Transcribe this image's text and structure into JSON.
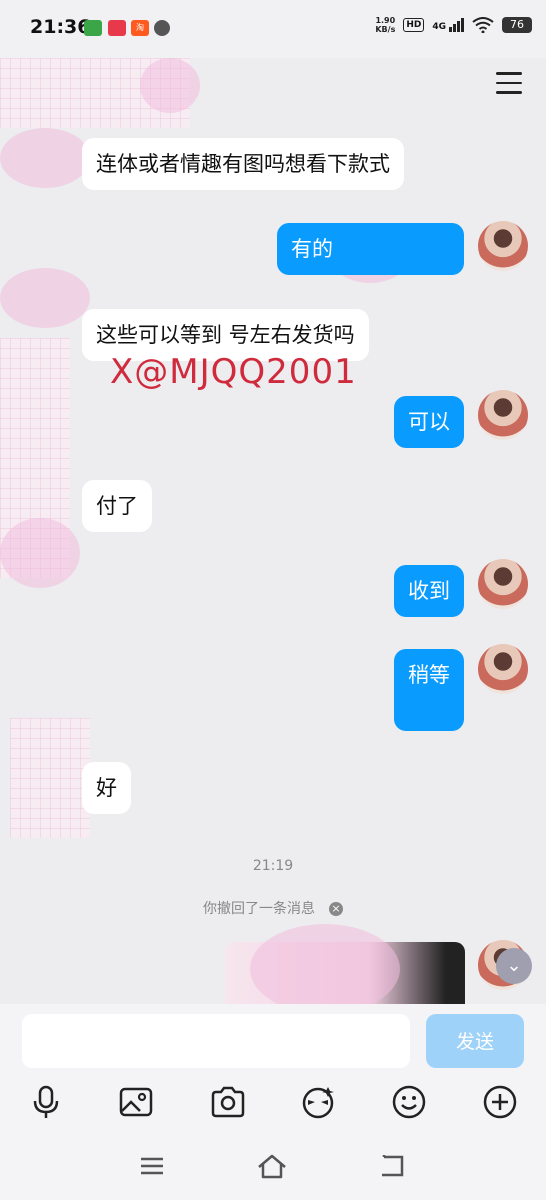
{
  "status_bar": {
    "time": "21:36",
    "net_speed_value": "1.90",
    "net_speed_unit": "KB/s",
    "hd_label": "HD",
    "network": "4G",
    "battery": "76"
  },
  "messages": [
    {
      "side": "in",
      "text": "连体或者情趣有图吗想看下款式"
    },
    {
      "side": "out",
      "text": "有的"
    },
    {
      "side": "in",
      "text": "这些可以等到     号左右发货吗"
    },
    {
      "side": "out",
      "text": "可以"
    },
    {
      "side": "in",
      "text": "付了"
    },
    {
      "side": "out",
      "text": "收到"
    },
    {
      "side": "out",
      "text": "稍等"
    },
    {
      "side": "in",
      "text": "好"
    }
  ],
  "watermark": "X@MJQQ2001",
  "timestamp": "21:19",
  "recall_notice": "你撤回了一条消息",
  "input": {
    "placeholder": "",
    "value": ""
  },
  "send_label": "发送",
  "toolbar_icons": [
    "microphone-icon",
    "image-icon",
    "camera-icon",
    "sticker-icon",
    "emoji-icon",
    "plus-icon"
  ],
  "navbar_icons": [
    "menu-icon",
    "home-icon",
    "back-icon"
  ],
  "colors": {
    "outgoing_bubble": "#0a9bff",
    "send_button": "#9fd2f8",
    "watermark": "#cf2b3d"
  }
}
